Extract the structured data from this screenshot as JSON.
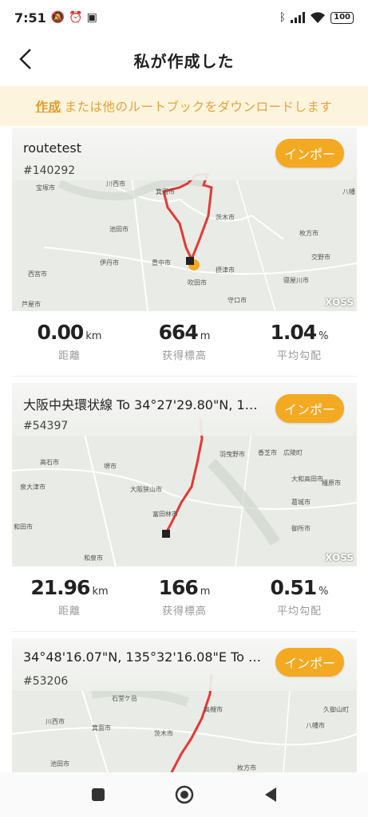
{
  "status": {
    "time": "7:51",
    "battery": "100"
  },
  "header": {
    "title": "私が作成した"
  },
  "banner": {
    "link_text": "作成",
    "text": "または他のルートブックをダウンロードします"
  },
  "routes": [
    {
      "name": "routetest",
      "id": "#140292",
      "import_label": "インポー",
      "stats": [
        {
          "value": "0.00",
          "unit": "km",
          "label": "距離"
        },
        {
          "value": "664",
          "unit": "m",
          "label": "获得標高"
        },
        {
          "value": "1.04",
          "unit": "%",
          "label": "平均勾配"
        }
      ],
      "map_labels": [
        "宝塚市",
        "川西市",
        "箕面市",
        "茨木市",
        "枚方市",
        "八幡",
        "交野市",
        "池田市",
        "伊丹市",
        "豊中市",
        "摂津市",
        "寝屋川市",
        "西宮市",
        "吹田市",
        "守口市",
        "芦屋市"
      ]
    },
    {
      "name": "大阪中央環状線 To 34°27'29.80\"N, 13...",
      "id": "#54397",
      "import_label": "インポー",
      "stats": [
        {
          "value": "21.96",
          "unit": "km",
          "label": "距離"
        },
        {
          "value": "166",
          "unit": "m",
          "label": "获得標高"
        },
        {
          "value": "0.51",
          "unit": "%",
          "label": "平均勾配"
        }
      ],
      "map_labels": [
        "高石市",
        "堺市",
        "羽曳野市",
        "香芝市",
        "広陵町",
        "泉大津市",
        "大阪狭山市",
        "大和高田市",
        "橿原市",
        "富田林市",
        "葛城市",
        "和田市",
        "御所市",
        "和泉市"
      ]
    },
    {
      "name": "34°48'16.07\"N, 135°32'16.08\"E To 34...",
      "id": "#53206",
      "import_label": "インポー",
      "map_labels": [
        "石堂ケ岳",
        "高槻市",
        "八幡市",
        "久御山町",
        "川西市",
        "箕面市",
        "茨木市",
        "池田市",
        "枚方市"
      ]
    }
  ],
  "xoss_label": "XOSS",
  "colors": {
    "accent": "#f4a923",
    "banner_bg": "#fdf4de",
    "banner_text": "#e6a13c",
    "route": "#e53935"
  }
}
